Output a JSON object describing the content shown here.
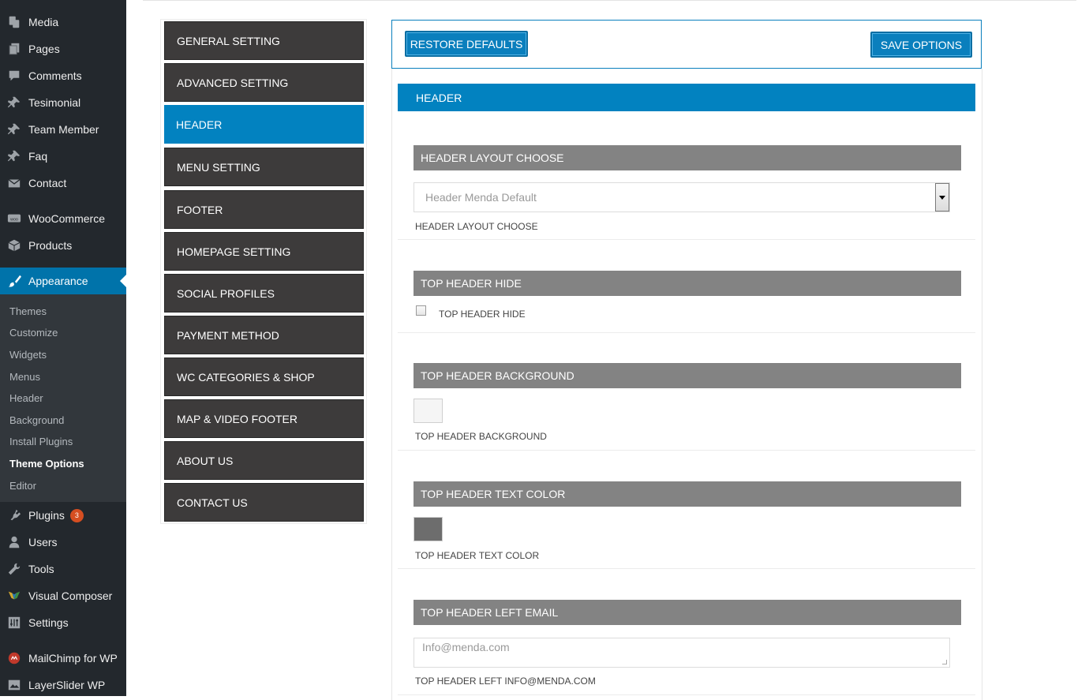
{
  "wp_menu": {
    "items": [
      {
        "label": "Media",
        "icon": "media-icon"
      },
      {
        "label": "Pages",
        "icon": "pages-icon"
      },
      {
        "label": "Comments",
        "icon": "comments-icon"
      },
      {
        "label": "Tesimonial",
        "icon": "pin-icon"
      },
      {
        "label": "Team Member",
        "icon": "pin-icon"
      },
      {
        "label": "Faq",
        "icon": "pin-icon"
      },
      {
        "label": "Contact",
        "icon": "envelope-icon"
      },
      {
        "label": "WooCommerce",
        "icon": "woocommerce-icon"
      },
      {
        "label": "Products",
        "icon": "box-icon"
      },
      {
        "label": "Appearance",
        "icon": "paintbrush-icon"
      },
      {
        "label": "Plugins",
        "icon": "plug-icon",
        "badge": "3"
      },
      {
        "label": "Users",
        "icon": "user-icon"
      },
      {
        "label": "Tools",
        "icon": "wrench-icon"
      },
      {
        "label": "Visual Composer",
        "icon": "visual-composer-icon"
      },
      {
        "label": "Settings",
        "icon": "sliders-icon"
      },
      {
        "label": "MailChimp for WP",
        "icon": "mailchimp-icon"
      },
      {
        "label": "LayerSlider WP",
        "icon": "layers-icon"
      }
    ],
    "appearance_submenu": [
      "Themes",
      "Customize",
      "Widgets",
      "Menus",
      "Header",
      "Background",
      "Install Plugins",
      "Theme Options",
      "Editor"
    ],
    "active_submenu": "Theme Options",
    "current_item": "Appearance"
  },
  "theme_nav": {
    "items": [
      "GENERAL SETTING",
      "ADVANCED SETTING",
      "HEADER",
      "MENU SETTING",
      "FOOTER",
      "HOMEPAGE SETTING",
      "SOCIAL PROFILES",
      "PAYMENT METHOD",
      "WC CATEGORIES & SHOP",
      "MAP & VIDEO FOOTER",
      "ABOUT US",
      "CONTACT US"
    ],
    "active": "HEADER"
  },
  "actions": {
    "restore": "RESTORE DEFAULTS",
    "save": "SAVE OPTIONS"
  },
  "section": {
    "title": "HEADER",
    "fields": [
      {
        "heading": "HEADER LAYOUT CHOOSE",
        "type": "select",
        "value": "Header Menda Default",
        "caption": "HEADER LAYOUT CHOOSE"
      },
      {
        "heading": "TOP HEADER HIDE",
        "type": "checkbox",
        "checked": false,
        "caption": "TOP HEADER HIDE"
      },
      {
        "heading": "TOP HEADER BACKGROUND",
        "type": "color",
        "value": "#f5f5f5",
        "caption": "TOP HEADER BACKGROUND"
      },
      {
        "heading": "TOP HEADER TEXT COLOR",
        "type": "color",
        "value": "#6d6d6d",
        "caption": "TOP HEADER TEXT COLOR"
      },
      {
        "heading": "TOP HEADER LEFT EMAIL",
        "type": "textarea",
        "value": "Info@menda.com",
        "caption": "TOP HEADER LEFT INFO@MENDA.COM"
      }
    ]
  },
  "colors": {
    "accent": "#0282c0",
    "nav_bg": "#3d3b3b",
    "field_header": "#838383",
    "wp_sidebar": "#23282d"
  }
}
